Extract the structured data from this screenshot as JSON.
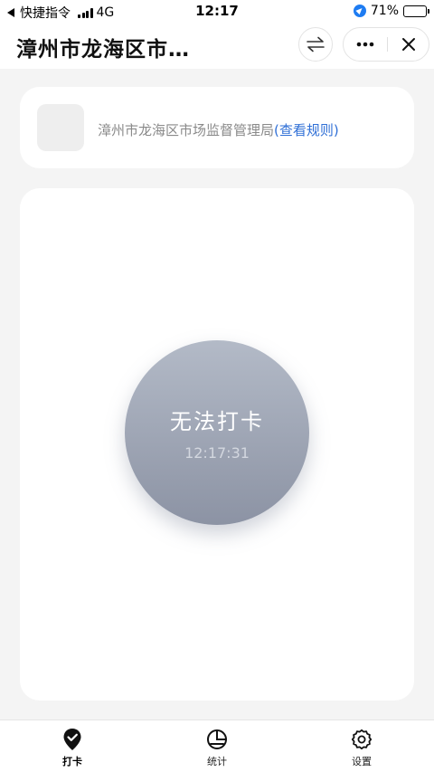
{
  "status_bar": {
    "back_app": "快捷指令",
    "network": "4G",
    "time": "12:17",
    "battery": "71%",
    "battery_level": 0.71
  },
  "header": {
    "title": "漳州市龙海区市…"
  },
  "org": {
    "name": "漳州市龙海区市场监督管理局",
    "rules_link": "(查看规则)"
  },
  "punch": {
    "label": "无法打卡",
    "time": "12:17:31"
  },
  "tabs": [
    {
      "label": "打卡",
      "icon": "location-check-icon",
      "active": true
    },
    {
      "label": "统计",
      "icon": "pie-chart-icon",
      "active": false
    },
    {
      "label": "设置",
      "icon": "gear-icon",
      "active": false
    }
  ],
  "colors": {
    "accent_link": "#2f6fd6",
    "punch_button_top": "#b3bac7",
    "punch_button_bottom": "#8c93a4",
    "page_background": "#f4f4f4"
  }
}
